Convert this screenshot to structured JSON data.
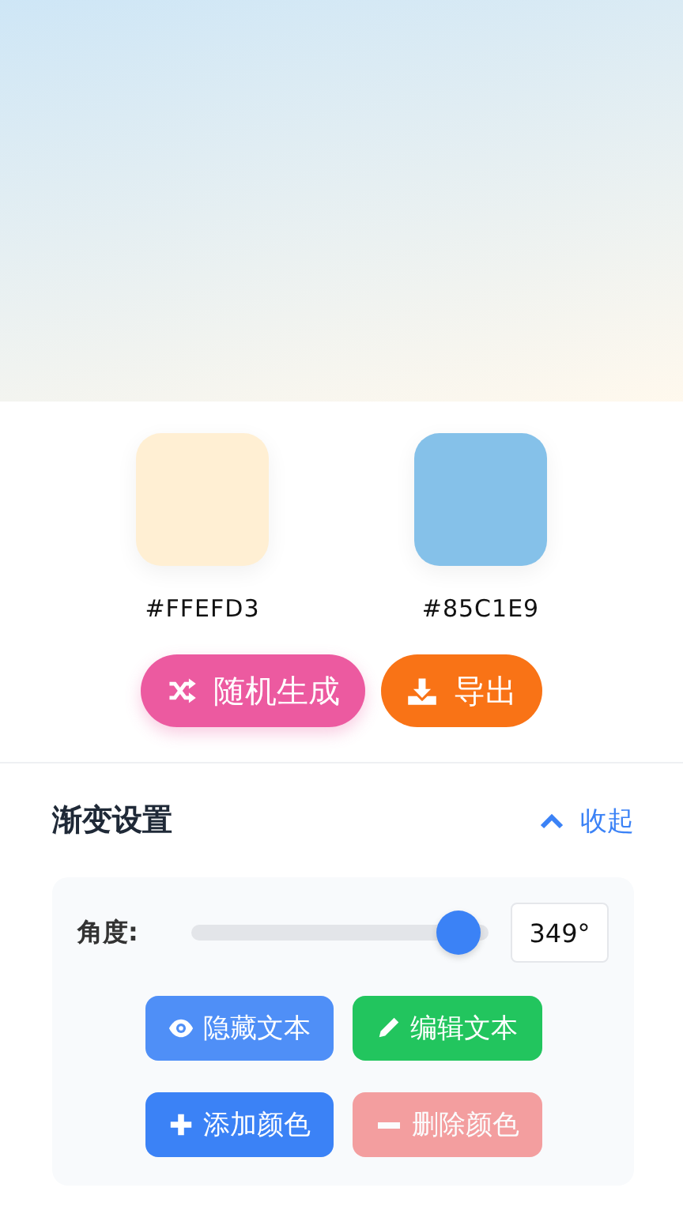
{
  "colors": [
    {
      "hex": "#FFEFD3",
      "color": "#ffefd3"
    },
    {
      "hex": "#85C1E9",
      "color": "#85c1e9"
    }
  ],
  "actions": [
    {
      "kind": "shuffle",
      "label": "随机生成"
    },
    {
      "kind": "export",
      "label": "导出"
    }
  ],
  "settings": {
    "title": "渐变设置",
    "toggle": "收起",
    "expanded": true,
    "angle": {
      "label": "角度:",
      "level": 0.97,
      "reading": "349°"
    },
    "buttons": [
      {
        "kind": "eye",
        "label": "隐藏文本",
        "disabled": false
      },
      {
        "kind": "pencil",
        "label": "编辑文本",
        "disabled": false
      },
      {
        "kind": "plus",
        "label": "添加颜色",
        "disabled": false
      },
      {
        "kind": "minus",
        "label": "删除颜色",
        "disabled": true
      }
    ]
  }
}
